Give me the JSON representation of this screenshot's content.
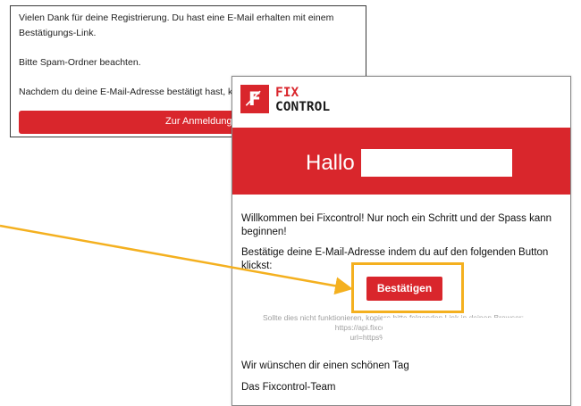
{
  "registration": {
    "line1": "Vielen Dank für deine Registrierung. Du hast eine E-Mail erhalten mit einem",
    "line2": "Bestätigungs-Link.",
    "spam_note": "Bitte Spam-Ordner beachten.",
    "after_confirm": "Nachdem du deine E-Mail-Adresse bestätigt hast, kann",
    "login_button": "Zur Anmeldung"
  },
  "email": {
    "logo_mark": "F̸",
    "brand_line1": "FIX",
    "brand_line2": "CONTROL",
    "greeting": "Hallo",
    "welcome_line1": "Willkommen bei Fixcontrol! Nur noch ein Schritt und der Spass kann",
    "welcome_line2": "beginnen!",
    "instruction": "Bestätige deine E-Mail-Adresse indem du auf den folgenden Button klickst:",
    "confirm_button": "Bestätigen",
    "fallback_line1": "Sollte dies nicht funktionieren, kopiere bitte folgenden Link in deinen Browser:",
    "fallback_line2": "https://api.fixcontrol.ch/v1/users/co",
    "fallback_line3": "url=https%253A%2F%2Fi",
    "closing": "Wir wünschen dir einen schönen Tag",
    "signature": "Das Fixcontrol-Team"
  },
  "colors": {
    "brand_red": "#d9262c",
    "highlight": "#f4b01f"
  }
}
